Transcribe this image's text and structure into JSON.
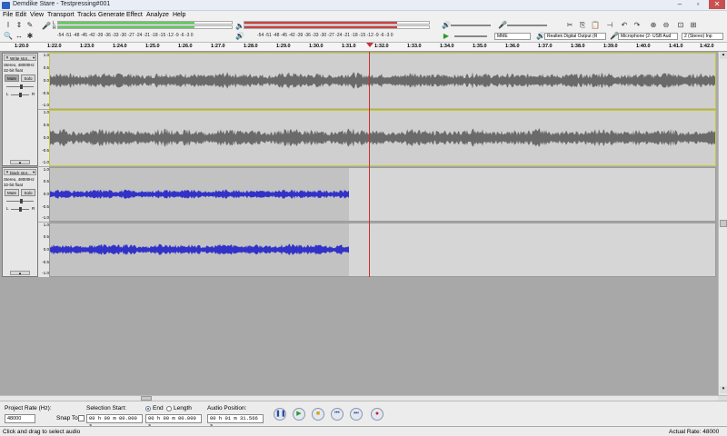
{
  "window": {
    "title": "Demdike Stare - Testpressing#001"
  },
  "menu": [
    "File",
    "Edit",
    "View",
    "Transport",
    "Tracks",
    "Generate",
    "Effect",
    "Analyze",
    "Help"
  ],
  "meters": {
    "scale": "-54 -51 -48 -45 -42 -39 -36 -33 -30 -27 -24 -21 -18 -15 -12 -9 -6 -3 0",
    "playback_scale": "-54 -51 -48 -45 -42 -39 -36 -33 -30 -27 -24 -21 -18 -15 -12 -9 -6 -3 0",
    "left_label": "L",
    "right_label": "R"
  },
  "devices": {
    "host": "MME",
    "output": "Realtek Digital Output (R",
    "input": "Microphone (2- USB Aud",
    "channels": "2 (Stereo) Inp"
  },
  "ruler": {
    "labels": [
      "1:20.0",
      "1:22.0",
      "1:23.0",
      "1:24.0",
      "1:25.0",
      "1:26.0",
      "1:27.0",
      "1:28.0",
      "1:29.0",
      "1:30.0",
      "1:31.0",
      "1:32.0",
      "1:33.0",
      "1:34.0",
      "1:35.0",
      "1:36.0",
      "1:37.0",
      "1:38.0",
      "1:39.0",
      "1:40.0",
      "1:41.0",
      "1:42.0"
    ]
  },
  "tracks": [
    {
      "name": "Write stor...",
      "info1": "Stereo, 48000Hz",
      "info2": "32-bit float",
      "mute": "Mute",
      "solo": "Solo",
      "left": "L",
      "right": "R",
      "scale_top": [
        "1.0",
        "0.5",
        "0.0",
        "-0.5",
        "-1.0"
      ],
      "scale_bot": [
        "1.0",
        "0.5",
        "0.0",
        "-0.5",
        "-1.0"
      ],
      "color": "#6a6a6a"
    },
    {
      "name": "black stor...",
      "info1": "Stereo, 48000Hz",
      "info2": "32-bit float",
      "mute": "Mute",
      "solo": "Solo",
      "left": "L",
      "right": "R",
      "scale_top": [
        "1.0",
        "0.5",
        "0.0",
        "-0.5",
        "-1.0"
      ],
      "scale_bot": [
        "1.0",
        "0.5",
        "0.0",
        "-0.5",
        "-1.0"
      ],
      "color": "#3232c8"
    }
  ],
  "selection": {
    "project_rate_label": "Project Rate (Hz):",
    "project_rate": "48000",
    "snap_label": "Snap To",
    "start_label": "Selection Start:",
    "end_label": "End",
    "length_label": "Length",
    "audio_pos_label": "Audio Position:",
    "start_value": "00 h 00 m 00.000 s",
    "end_value": "00 h 00 m 00.000 s",
    "audio_pos_value": "00 h 01 m 31.566 s"
  },
  "status": {
    "left": "Click and drag to select audio",
    "right": "Actual Rate: 48000"
  },
  "colors": {
    "meter_green": "#5ad25a",
    "meter_red": "#d24040",
    "playhead": "#c83232",
    "wave_grey": "#6a6a6a",
    "wave_blue": "#3232c8"
  }
}
